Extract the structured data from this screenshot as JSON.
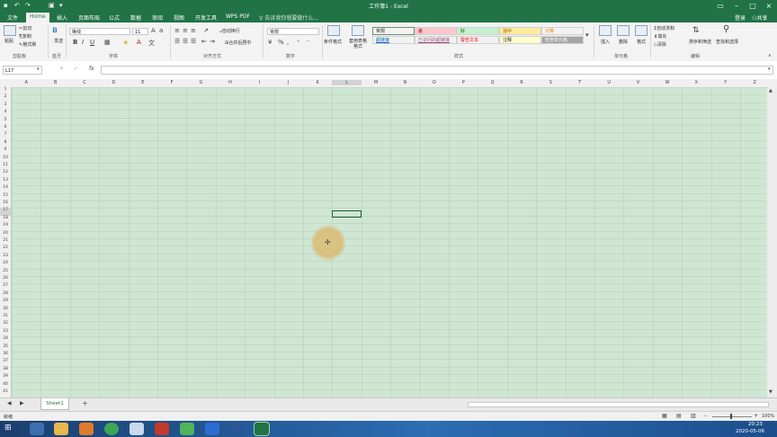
{
  "window": {
    "title": "工作簿1 - Excel"
  },
  "menu": {
    "tabs": [
      "文件",
      "Home",
      "插入",
      "页面布局",
      "公式",
      "数据",
      "审阅",
      "视图",
      "开发工具",
      "WPS PDF"
    ],
    "search_placeholder": "告诉我你想要做什么...",
    "login": "登录",
    "share": "共享"
  },
  "ribbon": {
    "clipboard": {
      "paste": "粘贴",
      "cut": "剪切",
      "copy": "复制",
      "format_painter": "格式刷",
      "label": "剪贴板"
    },
    "bluetooth": {
      "send": "发送",
      "label": "蓝牙"
    },
    "font": {
      "name": "等线",
      "size": "11",
      "bold": "B",
      "italic": "I",
      "underline": "U",
      "label": "字体"
    },
    "alignment": {
      "wrap": "自动换行",
      "merge": "合并后居中",
      "label": "对齐方式"
    },
    "number": {
      "format": "常规",
      "label": "数字"
    },
    "styles": {
      "conditional": "条件格式",
      "table_format": "套用表格格式",
      "cells": [
        {
          "text": "常规",
          "bg": "#ffffff"
        },
        {
          "text": "差",
          "bg": "#ffc7ce"
        },
        {
          "text": "好",
          "bg": "#c6efce"
        },
        {
          "text": "适中",
          "bg": "#ffeb9c"
        },
        {
          "text": "计算",
          "bg": "#f2f2f2"
        },
        {
          "text": "超链接",
          "bg": "#ffffff"
        },
        {
          "text": "已访问的超链接",
          "bg": "#ffffff"
        },
        {
          "text": "警告文本",
          "bg": "#ffffff"
        },
        {
          "text": "注释",
          "bg": "#ffffcc"
        },
        {
          "text": "检查单元格",
          "bg": "#a5a5a5"
        }
      ],
      "label": "样式"
    },
    "cells_group": {
      "insert": "插入",
      "delete": "删除",
      "format": "格式",
      "label": "单元格"
    },
    "editing": {
      "autosum": "自动求和",
      "fill": "填充",
      "clear": "清除",
      "sort_filter": "排序和筛选",
      "find_select": "查找和选择",
      "label": "编辑"
    }
  },
  "formula_bar": {
    "name_box": "L17",
    "fx": "fx"
  },
  "grid": {
    "columns": [
      "A",
      "B",
      "C",
      "D",
      "E",
      "F",
      "G",
      "H",
      "I",
      "J",
      "K",
      "L",
      "M",
      "N",
      "O",
      "P",
      "Q",
      "R",
      "S",
      "T",
      "U",
      "V",
      "W",
      "X",
      "Y",
      "Z"
    ],
    "rows": [
      "1",
      "2",
      "3",
      "4",
      "5",
      "6",
      "7",
      "8",
      "9",
      "10",
      "11",
      "12",
      "13",
      "14",
      "15",
      "16",
      "17",
      "18",
      "19",
      "20",
      "21",
      "22",
      "23",
      "24",
      "25",
      "26",
      "27",
      "28",
      "29",
      "30",
      "31",
      "32",
      "33",
      "34",
      "35",
      "36",
      "37",
      "38",
      "39",
      "40",
      "41"
    ]
  },
  "sheets": {
    "tabs": [
      "Sheet1"
    ],
    "add": "+"
  },
  "status": {
    "ready": "就绪",
    "zoom": "100%"
  },
  "taskbar": {
    "time": "20:23",
    "date": "2020-05-06"
  },
  "colors": {
    "excel_green": "#217346",
    "grid_bg": "#cfe6d3",
    "taskbar": "#2c6db3"
  }
}
